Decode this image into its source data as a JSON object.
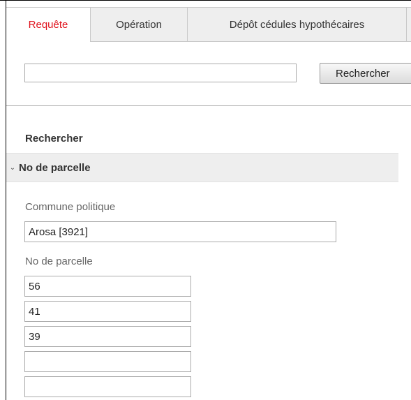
{
  "tabs": [
    {
      "label": "Requête",
      "active": true
    },
    {
      "label": "Opération",
      "active": false
    },
    {
      "label": "Dépôt cédules hypothécaires",
      "active": false
    }
  ],
  "search": {
    "value": "",
    "placeholder": "",
    "button_label": "Rechercher"
  },
  "section": {
    "title": "Rechercher"
  },
  "accordion": {
    "label": "No de parcelle",
    "icon": "chevron-down-icon",
    "expanded": true
  },
  "commune": {
    "label": "Commune politique",
    "value": "Arosa [3921]"
  },
  "parcels": {
    "label": "No de parcelle",
    "values": [
      "56",
      "41",
      "39",
      "",
      ""
    ]
  },
  "colors": {
    "active_tab_text": "#e0141e",
    "tab_background": "#eeeeee",
    "accordion_background": "#eeeeee",
    "border": "#aaaaaa"
  }
}
